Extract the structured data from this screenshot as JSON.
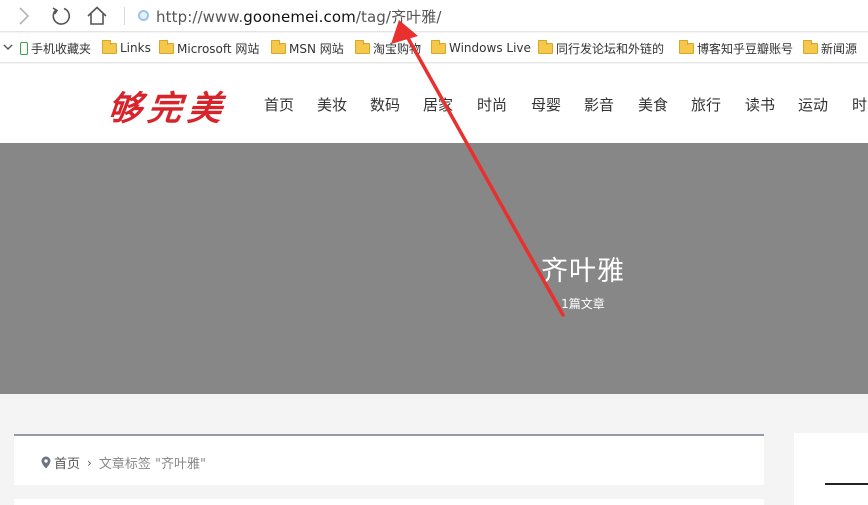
{
  "browser": {
    "url_prefix": "http://www.",
    "url_domain": "goonemei.com",
    "url_path": "/tag/齐叶雅/"
  },
  "bookmarks": [
    {
      "label": "手机收藏夹",
      "icon": "phone-icon"
    },
    {
      "label": "Links",
      "icon": "folder-icon"
    },
    {
      "label": "Microsoft 网站",
      "icon": "folder-icon"
    },
    {
      "label": "MSN 网站",
      "icon": "folder-icon"
    },
    {
      "label": "淘宝购物",
      "icon": "folder-icon"
    },
    {
      "label": "Windows Live",
      "icon": "folder-icon"
    },
    {
      "label": "同行发论坛和外链的",
      "icon": "folder-icon"
    },
    {
      "label": "博客知乎豆瓣账号",
      "icon": "folder-icon"
    },
    {
      "label": "新闻源",
      "icon": "folder-icon"
    }
  ],
  "site": {
    "logo": "够完美",
    "nav": [
      "首页",
      "美妆",
      "数码",
      "居家",
      "时尚",
      "母婴",
      "影音",
      "美食",
      "旅行",
      "读书",
      "运动",
      "时"
    ]
  },
  "banner": {
    "title": "齐叶雅",
    "count": "1篇文章"
  },
  "breadcrumb": {
    "home": "首页",
    "separator": "›",
    "current": "文章标签 \"齐叶雅\""
  },
  "colors": {
    "logo": "#d8232a",
    "banner": "#878787",
    "annotation_arrow": "#e8312f"
  }
}
